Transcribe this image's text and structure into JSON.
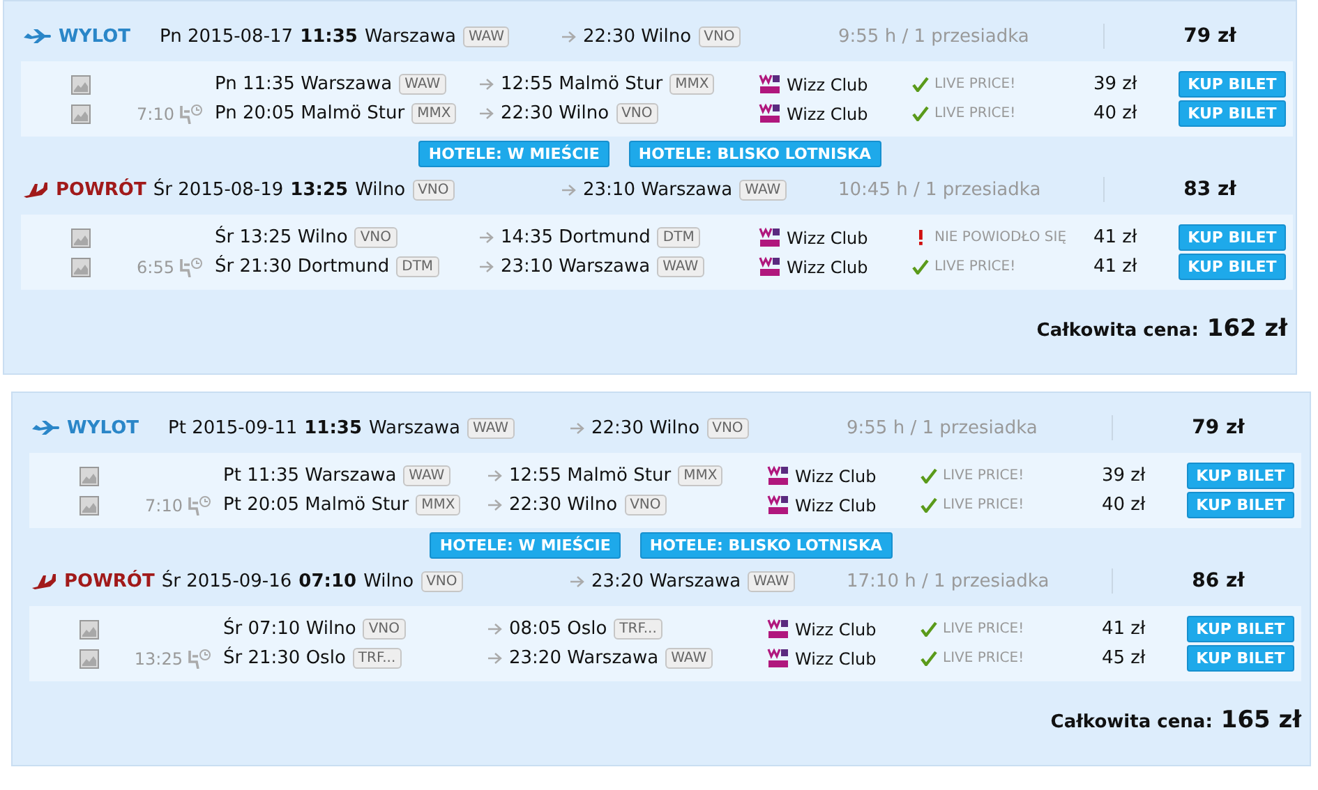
{
  "itineraries": [
    {
      "legs": [
        {
          "kind": "outbound",
          "label": "WYLOT",
          "day": "Pn",
          "date": "2015-08-17",
          "time": "11:35",
          "from": "Warszawa",
          "from_code": "WAW",
          "arrival_time": "22:30",
          "to": "Wilno",
          "to_code": "VNO",
          "duration": "9:55 h / 1 przesiadka",
          "price": "79 zł",
          "segments": [
            {
              "depart": "Pn 11:35 Warszawa",
              "depart_code": "WAW",
              "arrive": "12:55 Malmö Stur",
              "arrive_code": "MMX",
              "airline": "Wizz Club",
              "kind": "live",
              "status": "LIVE PRICE!",
              "price": "39 zł",
              "button": "KUP BILET"
            },
            {
              "layover": "7:10",
              "depart": "Pn 20:05 Malmö Stur",
              "depart_code": "MMX",
              "arrive": "22:30 Wilno",
              "arrive_code": "VNO",
              "airline": "Wizz Club",
              "kind": "live",
              "status": "LIVE PRICE!",
              "price": "40 zł",
              "button": "KUP BILET"
            }
          ]
        },
        {
          "kind": "return",
          "label": "POWRÓT",
          "day": "Śr",
          "date": "2015-08-19",
          "time": "13:25",
          "from": "Wilno",
          "from_code": "VNO",
          "arrival_time": "23:10",
          "to": "Warszawa",
          "to_code": "WAW",
          "duration": "10:45 h / 1 przesiadka",
          "price": "83 zł",
          "segments": [
            {
              "depart": "Śr 13:25 Wilno",
              "depart_code": "VNO",
              "arrive": "14:35 Dortmund",
              "arrive_code": "DTM",
              "airline": "Wizz Club",
              "kind": "failed",
              "status": "NIE POWIODŁO SIĘ",
              "price": "41 zł",
              "button": "KUP BILET"
            },
            {
              "layover": "6:55",
              "depart": "Śr 21:30 Dortmund",
              "depart_code": "DTM",
              "arrive": "23:10 Warszawa",
              "arrive_code": "WAW",
              "airline": "Wizz Club",
              "kind": "live",
              "status": "LIVE PRICE!",
              "price": "41 zł",
              "button": "KUP BILET"
            }
          ]
        }
      ],
      "hotel_buttons": [
        "HOTELE: W MIEŚCIE",
        "HOTELE: BLISKO LOTNISKA"
      ],
      "total": {
        "label": "Całkowita cena:",
        "value": "162 zł"
      }
    },
    {
      "legs": [
        {
          "kind": "outbound",
          "label": "WYLOT",
          "day": "Pt",
          "date": "2015-09-11",
          "time": "11:35",
          "from": "Warszawa",
          "from_code": "WAW",
          "arrival_time": "22:30",
          "to": "Wilno",
          "to_code": "VNO",
          "duration": "9:55 h / 1 przesiadka",
          "price": "79 zł",
          "segments": [
            {
              "depart": "Pt 11:35 Warszawa",
              "depart_code": "WAW",
              "arrive": "12:55 Malmö Stur",
              "arrive_code": "MMX",
              "airline": "Wizz Club",
              "kind": "live",
              "status": "LIVE PRICE!",
              "price": "39 zł",
              "button": "KUP BILET"
            },
            {
              "layover": "7:10",
              "depart": "Pt 20:05 Malmö Stur",
              "depart_code": "MMX",
              "arrive": "22:30 Wilno",
              "arrive_code": "VNO",
              "airline": "Wizz Club",
              "kind": "live",
              "status": "LIVE PRICE!",
              "price": "40 zł",
              "button": "KUP BILET"
            }
          ]
        },
        {
          "kind": "return",
          "label": "POWRÓT",
          "day": "Śr",
          "date": "2015-09-16",
          "time": "07:10",
          "from": "Wilno",
          "from_code": "VNO",
          "arrival_time": "23:20",
          "to": "Warszawa",
          "to_code": "WAW",
          "duration": "17:10 h / 1 przesiadka",
          "price": "86 zł",
          "segments": [
            {
              "depart": "Śr 07:10 Wilno",
              "depart_code": "VNO",
              "arrive": "08:05 Oslo",
              "arrive_code": "TRF...",
              "airline": "Wizz Club",
              "kind": "live",
              "status": "LIVE PRICE!",
              "price": "41 zł",
              "button": "KUP BILET"
            },
            {
              "layover": "13:25",
              "depart": "Śr 21:30 Oslo",
              "depart_code": "TRF...",
              "arrive": "23:20 Warszawa",
              "arrive_code": "WAW",
              "airline": "Wizz Club",
              "kind": "live",
              "status": "LIVE PRICE!",
              "price": "45 zł",
              "button": "KUP BILET"
            }
          ]
        }
      ],
      "hotel_buttons": [
        "HOTELE: W MIEŚCIE",
        "HOTELE: BLISKO LOTNISKA"
      ],
      "total": {
        "label": "Całkowita cena:",
        "value": "165 zł"
      }
    }
  ]
}
